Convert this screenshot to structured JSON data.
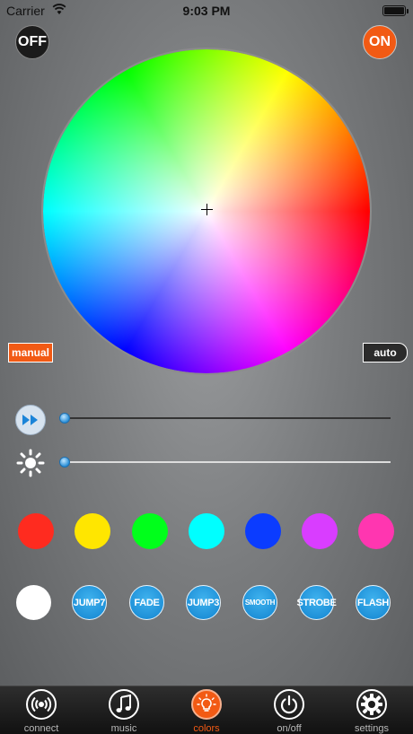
{
  "status_bar": {
    "carrier": "Carrier",
    "time": "9:03 PM"
  },
  "power": {
    "off_label": "OFF",
    "on_label": "ON"
  },
  "mode": {
    "manual_label": "manual",
    "auto_label": "auto"
  },
  "sliders": {
    "speed_value": 0.0,
    "brightness_value": 0.0
  },
  "colors": {
    "swatches": [
      "#ff2b1f",
      "#ffe600",
      "#00ff1b",
      "#00ffff",
      "#0b3cff",
      "#d93dff",
      "#ff36b0"
    ],
    "white": "#ffffff",
    "accent": "#f25a14"
  },
  "effects": [
    "JUMP7",
    "FADE",
    "JUMP3",
    "SMOOTH",
    "STROBE",
    "FLASH"
  ],
  "tabs": [
    {
      "label": "connect",
      "icon": "signal-icon"
    },
    {
      "label": "music",
      "icon": "music-note-icon"
    },
    {
      "label": "colors",
      "icon": "bulb-icon",
      "active": true
    },
    {
      "label": "on/off",
      "icon": "power-icon"
    },
    {
      "label": "settings",
      "icon": "gear-icon"
    }
  ]
}
